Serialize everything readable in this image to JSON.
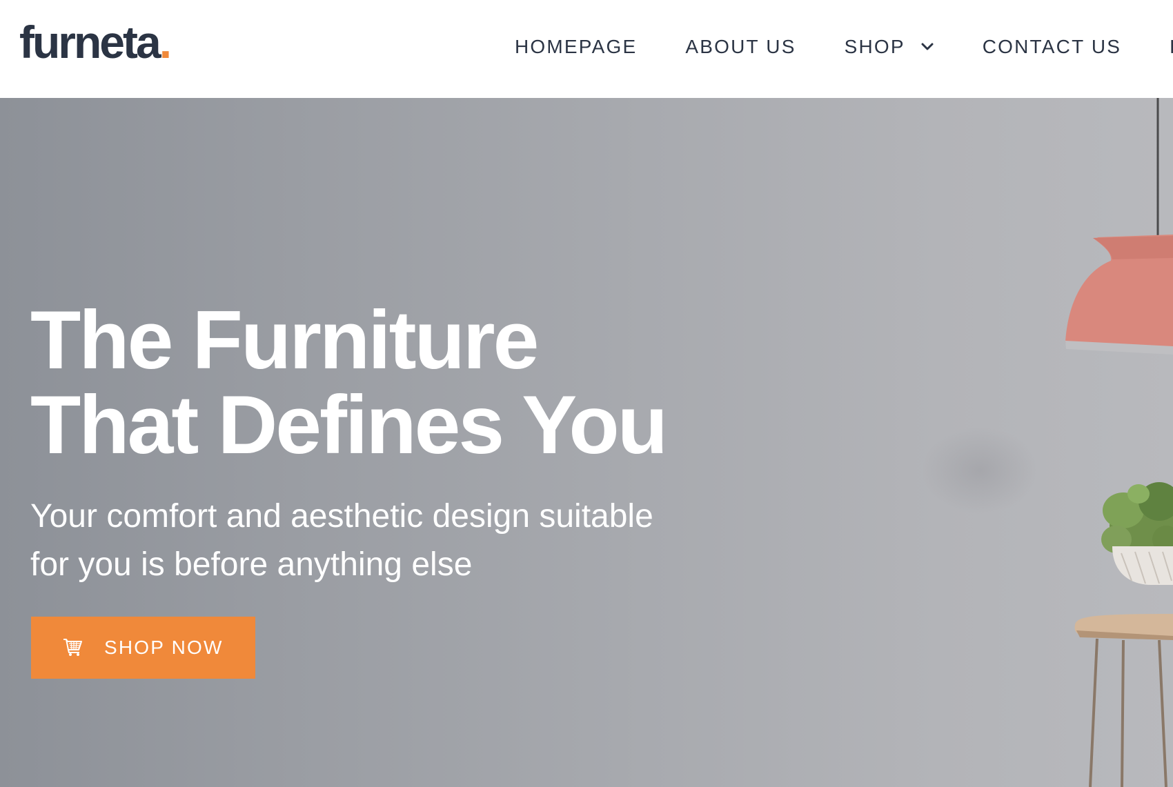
{
  "header": {
    "logo_text": "furneta",
    "logo_dot": ".",
    "nav": [
      {
        "label": "HOMEPAGE"
      },
      {
        "label": "ABOUT US"
      },
      {
        "label": "SHOP",
        "has_dropdown": true
      },
      {
        "label": "CONTACT US"
      },
      {
        "label": "F"
      }
    ]
  },
  "hero": {
    "title_line1": "The Furniture",
    "title_line2": "That Defines You",
    "subtitle_line1": "Your comfort and aesthetic design suitable",
    "subtitle_line2": "for you is before anything else",
    "cta_label": "SHOP NOW",
    "cta_icon": "cart-icon"
  },
  "colors": {
    "brand_dark": "#2b3444",
    "accent": "#f0893a",
    "hero_bg": "#a3a6ab",
    "lamp": "#d9887d"
  }
}
